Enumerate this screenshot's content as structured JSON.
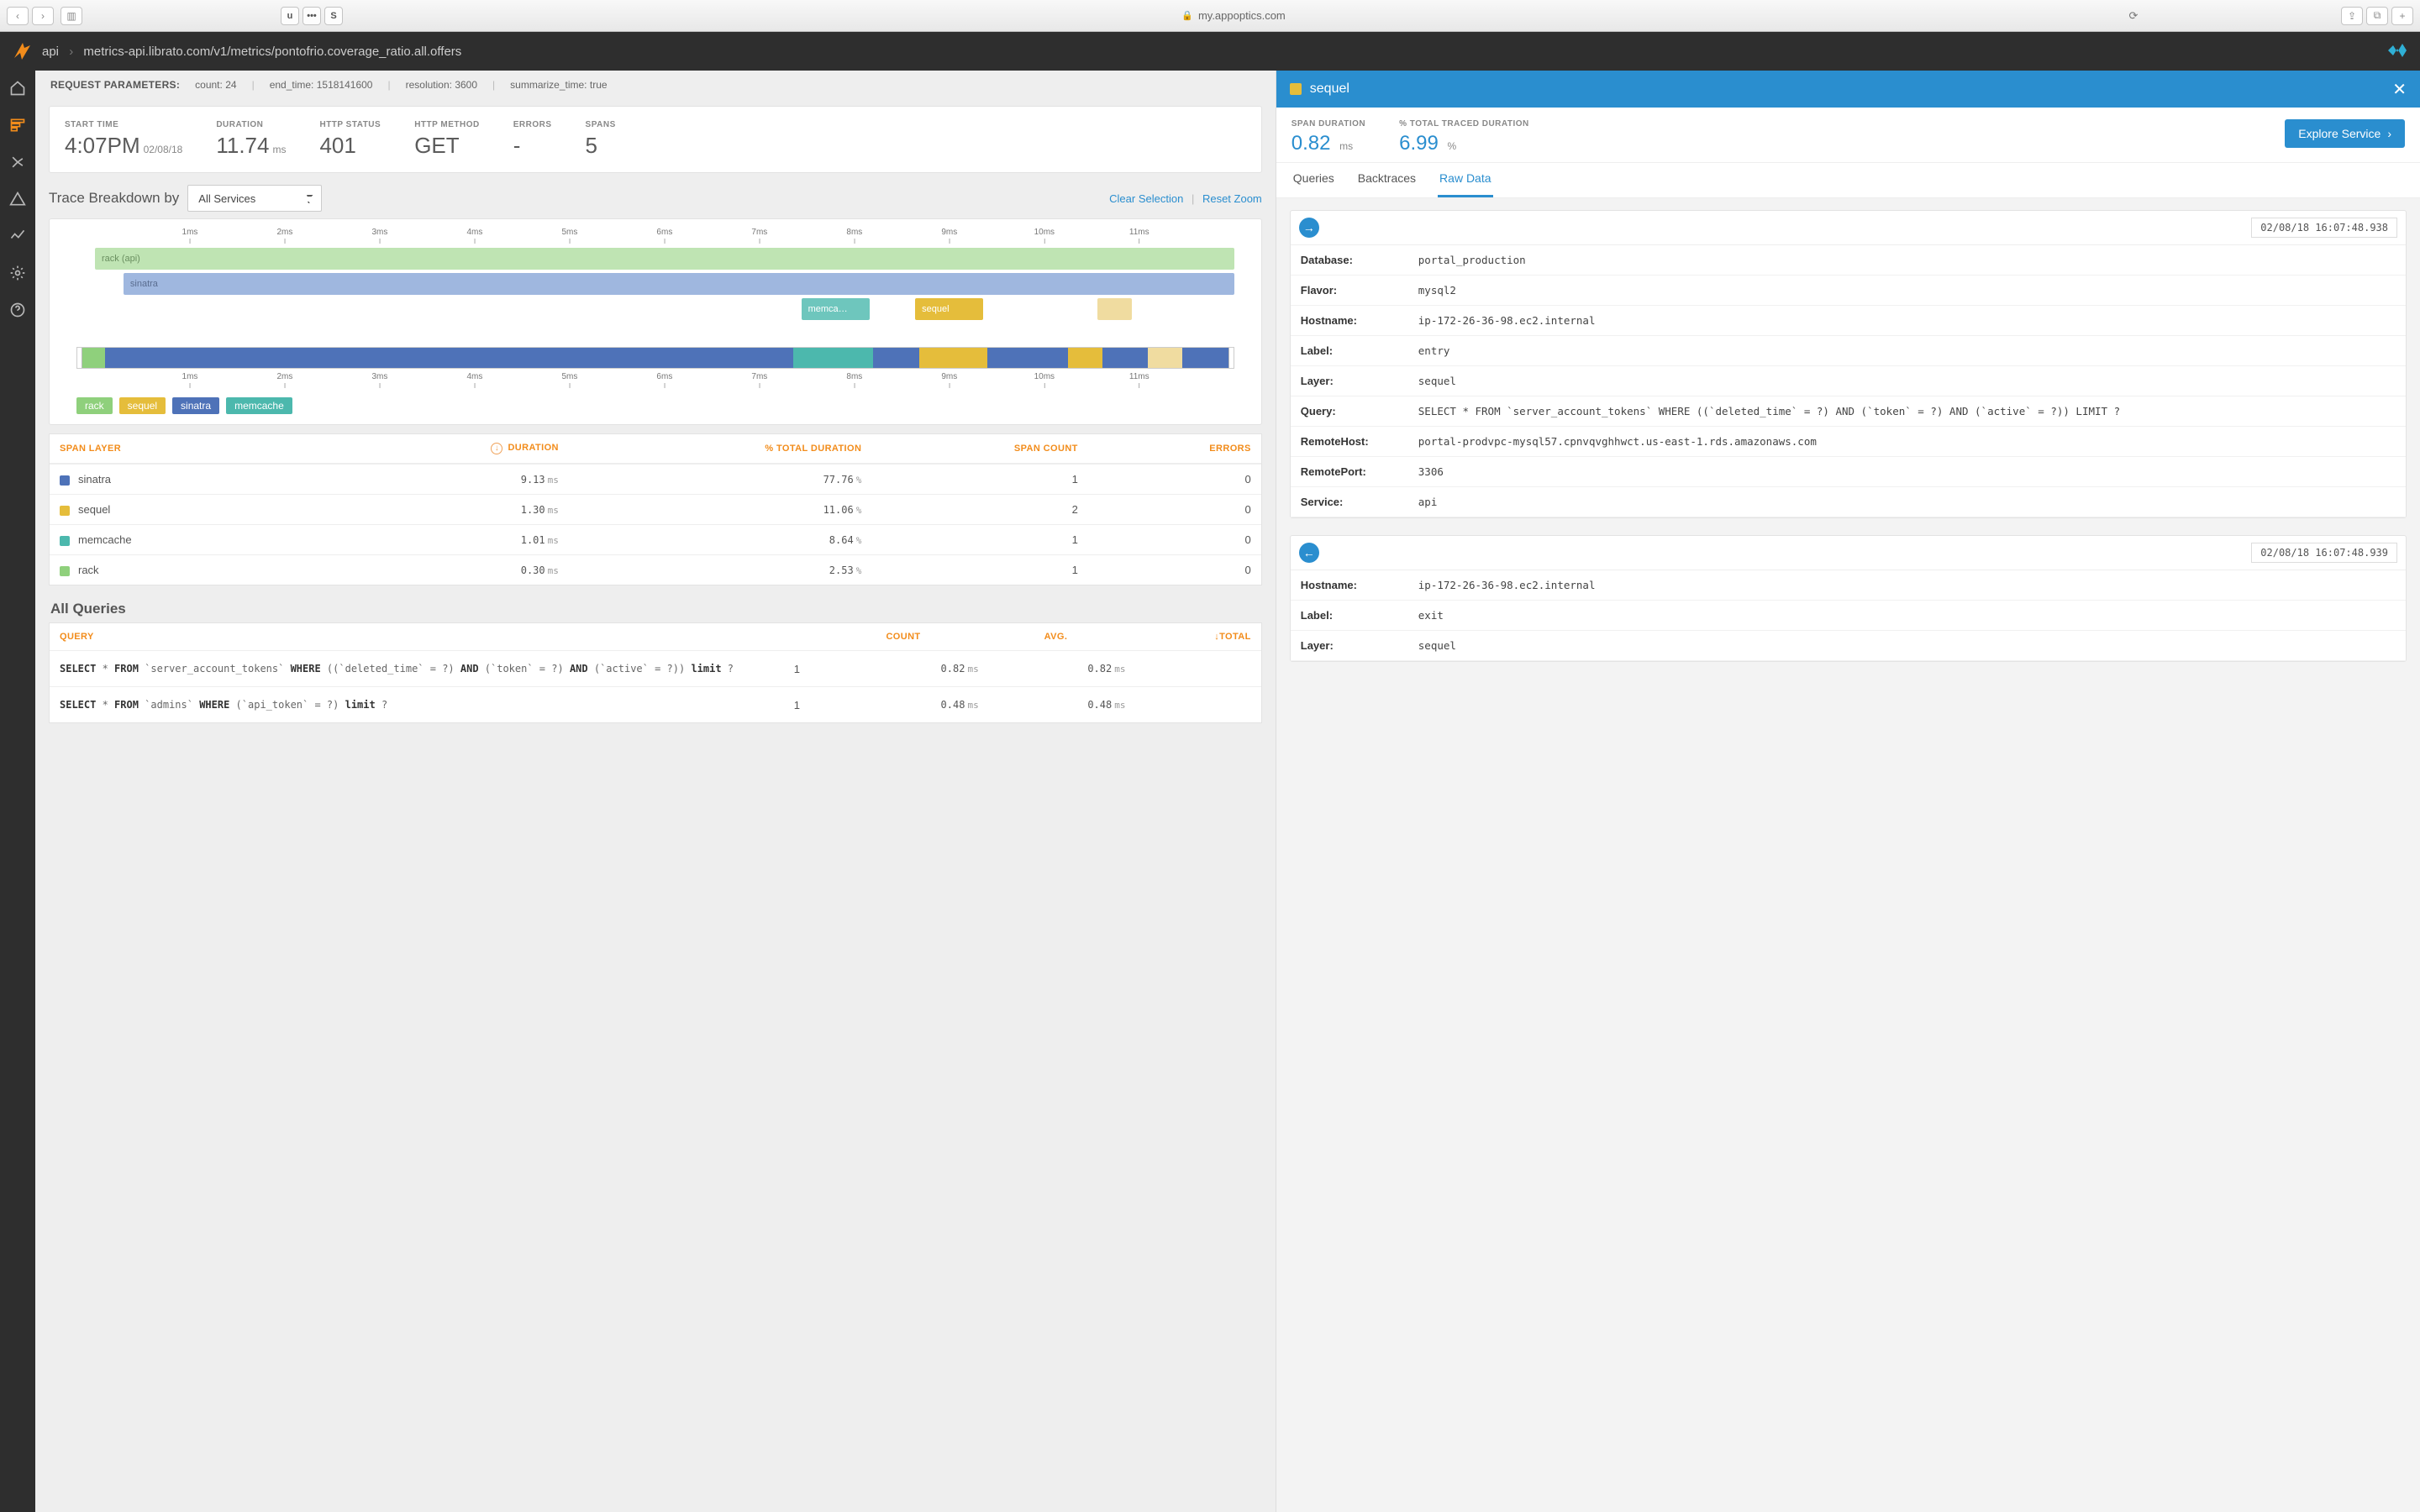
{
  "browser": {
    "url_host": "my.appoptics.com",
    "badges": [
      "u",
      "•••",
      "S"
    ]
  },
  "breadcrumb": {
    "root": "api",
    "path": "metrics-api.librato.com/v1/metrics/pontofrio.coverage_ratio.all.offers"
  },
  "request_params": {
    "label": "REQUEST PARAMETERS:",
    "count_label": "count:",
    "count": "24",
    "end_time_label": "end_time:",
    "end_time": "1518141600",
    "resolution_label": "resolution:",
    "resolution": "3600",
    "summarize_label": "summarize_time:",
    "summarize": "true"
  },
  "summary": {
    "start_time_label": "START TIME",
    "start_time": "4:07PM",
    "start_date": "02/08/18",
    "duration_label": "DURATION",
    "duration": "11.74",
    "duration_unit": "ms",
    "status_label": "HTTP STATUS",
    "status": "401",
    "method_label": "HTTP METHOD",
    "method": "GET",
    "errors_label": "ERRORS",
    "errors": "-",
    "spans_label": "SPANS",
    "spans": "5"
  },
  "trace_breakdown": {
    "title": "Trace Breakdown by",
    "selector": "All Services",
    "clear": "Clear Selection",
    "reset": "Reset Zoom",
    "ticks": [
      "1ms",
      "2ms",
      "3ms",
      "4ms",
      "5ms",
      "6ms",
      "7ms",
      "8ms",
      "9ms",
      "10ms",
      "11ms"
    ],
    "bars": {
      "rack": "rack (api)",
      "sinatra": "sinatra",
      "memcache": "memca…",
      "sequel": "sequel"
    },
    "legend": {
      "rack": "rack",
      "sequel": "sequel",
      "sinatra": "sinatra",
      "memcache": "memcache"
    }
  },
  "span_table": {
    "headers": {
      "layer": "SPAN LAYER",
      "duration": "DURATION",
      "pct": "% TOTAL DURATION",
      "count": "SPAN COUNT",
      "errors": "ERRORS"
    },
    "rows": [
      {
        "color": "#4e72b8",
        "layer": "sinatra",
        "duration": "9.13",
        "pct": "77.76",
        "count": "1",
        "errors": "0"
      },
      {
        "color": "#e5bd3b",
        "layer": "sequel",
        "duration": "1.30",
        "pct": "11.06",
        "count": "2",
        "errors": "0"
      },
      {
        "color": "#4cb8ad",
        "layer": "memcache",
        "duration": "1.01",
        "pct": "8.64",
        "count": "1",
        "errors": "0"
      },
      {
        "color": "#8fd07c",
        "layer": "rack",
        "duration": "0.30",
        "pct": "2.53",
        "count": "1",
        "errors": "0"
      }
    ]
  },
  "queries": {
    "title": "All Queries",
    "headers": {
      "query": "QUERY",
      "count": "COUNT",
      "avg": "AVG.",
      "total": "TOTAL"
    },
    "rows": [
      {
        "query": "SELECT * FROM `server_account_tokens` WHERE ((`deleted_time` = ?) AND (`token` = ?) AND (`active` = ?)) limit ?",
        "count": "1",
        "avg": "0.82",
        "total": "0.82"
      },
      {
        "query": "SELECT * FROM `admins` WHERE (`api_token` = ?) limit ?",
        "count": "1",
        "avg": "0.48",
        "total": "0.48"
      }
    ]
  },
  "right_panel": {
    "title": "sequel",
    "span_duration_label": "SPAN DURATION",
    "span_duration": "0.82",
    "span_duration_unit": "ms",
    "pct_label": "% TOTAL TRACED DURATION",
    "pct": "6.99",
    "pct_unit": "%",
    "explore": "Explore Service",
    "tabs": {
      "queries": "Queries",
      "backtraces": "Backtraces",
      "raw": "Raw Data"
    },
    "events": [
      {
        "dir": "right",
        "ts": "02/08/18 16:07:48.938",
        "kv": [
          [
            "Database:",
            "portal_production"
          ],
          [
            "Flavor:",
            "mysql2"
          ],
          [
            "Hostname:",
            "ip-172-26-36-98.ec2.internal"
          ],
          [
            "Label:",
            "entry"
          ],
          [
            "Layer:",
            "sequel"
          ],
          [
            "Query:",
            "SELECT * FROM `server_account_tokens` WHERE ((`deleted_time` = ?) AND (`token` = ?) AND (`active` = ?)) LIMIT ?"
          ],
          [
            "RemoteHost:",
            "portal-prodvpc-mysql57.cpnvqvghhwct.us-east-1.rds.amazonaws.com"
          ],
          [
            "RemotePort:",
            "3306"
          ],
          [
            "Service:",
            "api"
          ]
        ]
      },
      {
        "dir": "left",
        "ts": "02/08/18 16:07:48.939",
        "kv": [
          [
            "Hostname:",
            "ip-172-26-36-98.ec2.internal"
          ],
          [
            "Label:",
            "exit"
          ],
          [
            "Layer:",
            "sequel"
          ]
        ]
      }
    ]
  },
  "chart_data": {
    "type": "gantt-stack",
    "duration_ms": 11.74,
    "axis_ticks_ms": [
      1,
      2,
      3,
      4,
      5,
      6,
      7,
      8,
      9,
      10,
      11
    ],
    "spans": [
      {
        "layer": "rack",
        "label": "rack (api)",
        "start_ms": 0.0,
        "end_ms": 11.74,
        "color": "#bfe4b3"
      },
      {
        "layer": "sinatra",
        "label": "sinatra",
        "start_ms": 0.3,
        "end_ms": 11.74,
        "color": "#9fb7df"
      },
      {
        "layer": "memcache",
        "label": "memcache",
        "start_ms": 7.3,
        "end_ms": 8.3,
        "color": "#6ec6bd"
      },
      {
        "layer": "sequel",
        "label": "sequel",
        "start_ms": 8.5,
        "end_ms": 9.3,
        "color": "#e5bd3b"
      },
      {
        "layer": "sequel",
        "label": "sequel",
        "start_ms": 10.3,
        "end_ms": 10.8,
        "color": "#f0dca0"
      }
    ],
    "summary_bar": [
      {
        "layer": "rack",
        "pct": 2.53,
        "color": "#8fd07c"
      },
      {
        "layer": "sinatra",
        "pct": 77.76,
        "color": "#4e72b8"
      },
      {
        "layer": "memcache",
        "pct": 8.64,
        "color": "#4cb8ad"
      },
      {
        "layer": "sequel",
        "pct": 11.06,
        "color": "#e5bd3b"
      }
    ]
  }
}
